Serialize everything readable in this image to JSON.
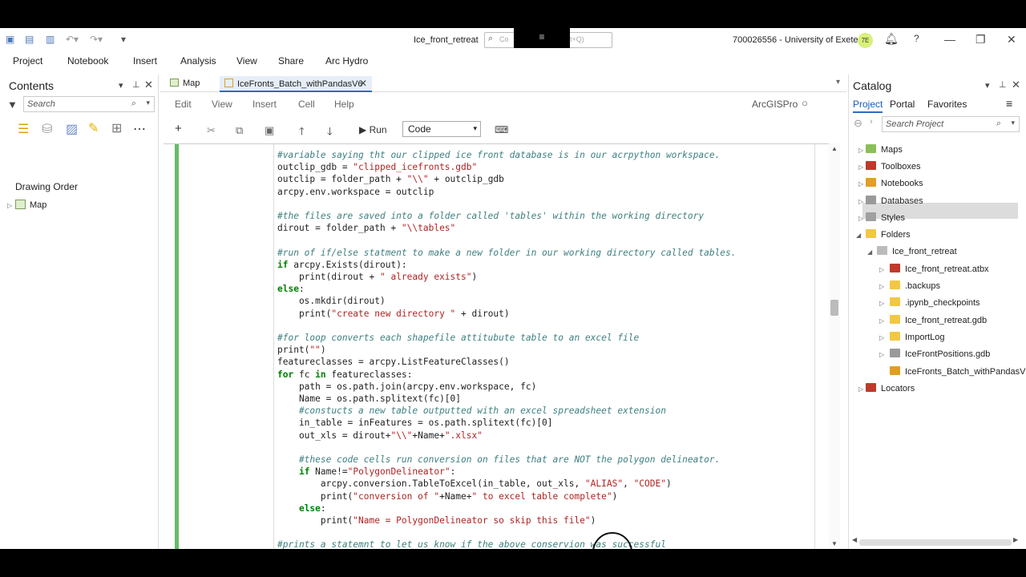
{
  "titlebar": {
    "title": "Ice_front_retreat",
    "command_search_placeholder": "Co",
    "command_search_shortcut": "t+Q)",
    "user": "700026556 - University of Exeter",
    "avatar_initials": "7E"
  },
  "ribbon": {
    "tabs": [
      "Project",
      "Notebook",
      "Insert",
      "Analysis",
      "View",
      "Share",
      "Arc Hydro"
    ]
  },
  "contents": {
    "title": "Contents",
    "search_placeholder": "Search",
    "drawing_order": "Drawing Order",
    "map_item": "Map"
  },
  "doc_tabs": [
    {
      "label": "Map"
    },
    {
      "label": "IceFronts_Batch_withPandasV6"
    }
  ],
  "notebook": {
    "menu": [
      "Edit",
      "View",
      "Insert",
      "Cell",
      "Help"
    ],
    "kernel": "ArcGISPro",
    "run_label": "Run",
    "cell_type": "Code"
  },
  "code_lines": [
    [
      [
        "cm",
        "#variable saying tht our clipped ice front database is in our acrpython workspace."
      ]
    ],
    [
      [
        "tx",
        "outclip_gdb = "
      ],
      [
        "st",
        "\"clipped_icefronts.gdb\""
      ]
    ],
    [
      [
        "tx",
        "outclip = folder_path + "
      ],
      [
        "st",
        "\"\\\\\""
      ],
      [
        "tx",
        " + outclip_gdb"
      ]
    ],
    [
      [
        "tx",
        "arcpy.env.workspace = outclip"
      ]
    ],
    [],
    [
      [
        "cm",
        "#the files are saved into a folder called 'tables' within the working directory"
      ]
    ],
    [
      [
        "tx",
        "dirout = folder_path + "
      ],
      [
        "st",
        "\"\\\\tables\""
      ]
    ],
    [],
    [
      [
        "cm",
        "#run of if/else statment to make a new folder in our working directory called tables."
      ]
    ],
    [
      [
        "kw",
        "if"
      ],
      [
        "tx",
        " arcpy.Exists(dirout):"
      ]
    ],
    [
      [
        "tx",
        "    print(dirout + "
      ],
      [
        "st",
        "\" already exists\""
      ],
      [
        "tx",
        ")"
      ]
    ],
    [
      [
        "kw",
        "else"
      ],
      [
        "tx",
        ":"
      ]
    ],
    [
      [
        "tx",
        "    os.mkdir(dirout)"
      ]
    ],
    [
      [
        "tx",
        "    print("
      ],
      [
        "st",
        "\"create new directory \""
      ],
      [
        "tx",
        " + dirout)"
      ]
    ],
    [],
    [
      [
        "cm",
        "#for loop converts each shapefile attitubute table to an excel file"
      ]
    ],
    [
      [
        "tx",
        "print("
      ],
      [
        "st",
        "\"\""
      ],
      [
        "tx",
        ")"
      ]
    ],
    [
      [
        "tx",
        "featureclasses = arcpy.ListFeatureClasses()"
      ]
    ],
    [
      [
        "kw",
        "for"
      ],
      [
        "tx",
        " fc "
      ],
      [
        "kw",
        "in"
      ],
      [
        "tx",
        " featureclasses:"
      ]
    ],
    [
      [
        "tx",
        "    path = os.path.join(arcpy.env.workspace, fc)"
      ]
    ],
    [
      [
        "tx",
        "    Name = os.path.splitext(fc)[0]"
      ]
    ],
    [
      [
        "cm",
        "    #constucts a new table outputted with an excel spreadsheet extension"
      ]
    ],
    [
      [
        "tx",
        "    in_table = inFeatures = os.path.splitext(fc)[0]"
      ]
    ],
    [
      [
        "tx",
        "    out_xls = dirout+"
      ],
      [
        "st",
        "\"\\\\\""
      ],
      [
        "tx",
        "+Name+"
      ],
      [
        "st",
        "\".xlsx\""
      ]
    ],
    [],
    [
      [
        "cm",
        "    #these code cells run conversion on files that are NOT the polygon delineator."
      ]
    ],
    [
      [
        "tx",
        "    "
      ],
      [
        "kw",
        "if"
      ],
      [
        "tx",
        " Name!="
      ],
      [
        "st",
        "\"PolygonDelineator\""
      ],
      [
        "tx",
        ":"
      ]
    ],
    [
      [
        "tx",
        "        arcpy.conversion.TableToExcel(in_table, out_xls, "
      ],
      [
        "st",
        "\"ALIAS\""
      ],
      [
        "tx",
        ", "
      ],
      [
        "st",
        "\"CODE\""
      ],
      [
        "tx",
        ")"
      ]
    ],
    [
      [
        "tx",
        "        print("
      ],
      [
        "st",
        "\"conversion of \""
      ],
      [
        "tx",
        "+Name+"
      ],
      [
        "st",
        "\" to excel table complete\""
      ],
      [
        "tx",
        ")"
      ]
    ],
    [
      [
        "tx",
        "    "
      ],
      [
        "kw",
        "else"
      ],
      [
        "tx",
        ":"
      ]
    ],
    [
      [
        "tx",
        "        print("
      ],
      [
        "st",
        "\"Name = PolygonDelineator so skip this file\""
      ],
      [
        "tx",
        ")"
      ]
    ],
    [],
    [
      [
        "cm",
        "#prints a statemnt to let us know if the above conservion was successful"
      ]
    ]
  ],
  "catalog": {
    "title": "Catalog",
    "tabs": [
      "Project",
      "Portal",
      "Favorites"
    ],
    "search_placeholder": "Search Project",
    "items": [
      {
        "label": "Maps",
        "icon": "maps-icon",
        "color": "#8bbf5a"
      },
      {
        "label": "Toolboxes",
        "icon": "toolbox-icon",
        "color": "#c0392b"
      },
      {
        "label": "Notebooks",
        "icon": "notebook-icon",
        "color": "#e0a020"
      },
      {
        "label": "Databases",
        "icon": "database-icon",
        "color": "#9a9a9a"
      },
      {
        "label": "Styles",
        "icon": "styles-icon",
        "color": "#a0a0a0"
      },
      {
        "label": "Folders",
        "icon": "folder-icon",
        "color": "#f2c744"
      },
      {
        "label": "Ice_front_retreat",
        "icon": "folder-link-icon",
        "color": "#bbbbbb"
      },
      {
        "label": "Ice_front_retreat.atbx",
        "icon": "toolbox-icon",
        "color": "#c0392b"
      },
      {
        "label": ".backups",
        "icon": "folder-icon",
        "color": "#f2c744"
      },
      {
        "label": ".ipynb_checkpoints",
        "icon": "folder-icon",
        "color": "#f2c744"
      },
      {
        "label": "Ice_front_retreat.gdb",
        "icon": "gdb-icon",
        "color": "#f2c744"
      },
      {
        "label": "ImportLog",
        "icon": "folder-icon",
        "color": "#f2c744"
      },
      {
        "label": "IceFrontPositions.gdb",
        "icon": "database-icon",
        "color": "#9a9a9a"
      },
      {
        "label": "IceFronts_Batch_withPandasV",
        "icon": "notebook-icon",
        "color": "#e0a020"
      },
      {
        "label": "Locators",
        "icon": "locator-icon",
        "color": "#c0392b"
      }
    ]
  }
}
